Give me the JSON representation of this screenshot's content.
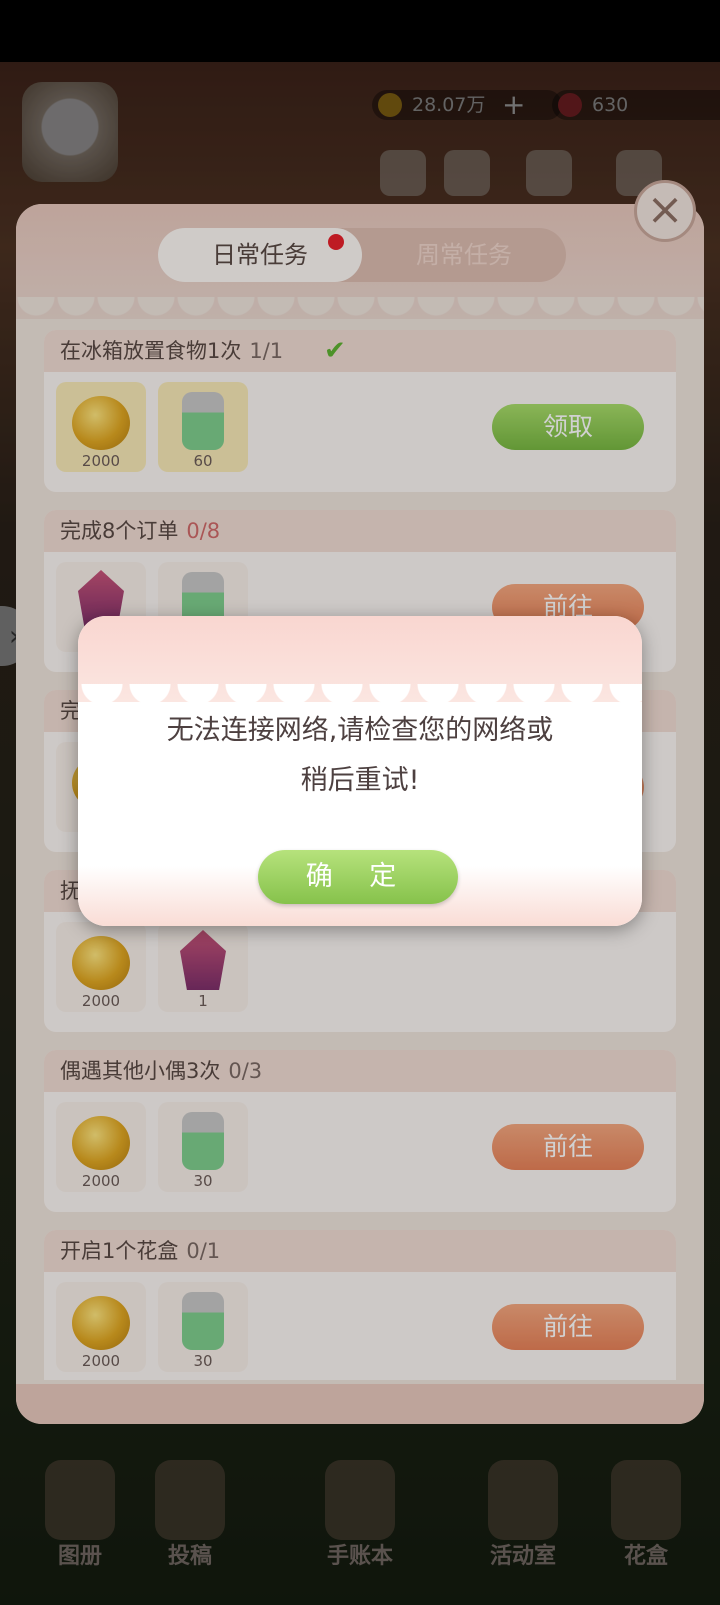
{
  "hud": {
    "gold_amount": "28.07万",
    "gold_plus": "+",
    "gem_amount": "630"
  },
  "panel": {
    "tabs": [
      {
        "label": "日常任务",
        "active": true,
        "has_dot": true
      },
      {
        "label": "周常任务",
        "active": false,
        "has_dot": false
      }
    ],
    "close_icon": "close-icon",
    "tasks": [
      {
        "title": "在冰箱放置食物1次",
        "progress": "1/1",
        "completed": true,
        "rewards": [
          {
            "icon": "gold-coin-icon",
            "qty": "2000"
          },
          {
            "icon": "time-bottle-icon",
            "qty": "60"
          }
        ],
        "action": "领取",
        "action_style": "green"
      },
      {
        "title": "完成8个订单",
        "progress": "0/8",
        "completed": false,
        "rewards": [
          {
            "icon": "gem-icon",
            "qty": ""
          },
          {
            "icon": "time-bottle-icon",
            "qty": ""
          }
        ],
        "action": "前往",
        "action_style": "orange"
      },
      {
        "title": "完",
        "progress": "",
        "completed": false,
        "rewards": [
          {
            "icon": "gold-coin-icon",
            "qty": ""
          }
        ],
        "action": "",
        "action_style": "orange"
      },
      {
        "title": "抚",
        "progress": "",
        "completed": false,
        "rewards": [
          {
            "icon": "gold-coin-icon",
            "qty": "2000"
          },
          {
            "icon": "purple-crystal-icon",
            "qty": "1"
          }
        ],
        "action": "",
        "action_style": "orange"
      },
      {
        "title": "偶遇其他小偶3次",
        "progress": "0/3",
        "completed": false,
        "rewards": [
          {
            "icon": "gold-coin-icon",
            "qty": "2000"
          },
          {
            "icon": "time-bottle-icon",
            "qty": "30"
          }
        ],
        "action": "前往",
        "action_style": "orange"
      },
      {
        "title": "开启1个花盒",
        "progress": "0/1",
        "completed": false,
        "rewards": [
          {
            "icon": "gold-coin-icon",
            "qty": "2000"
          },
          {
            "icon": "time-bottle-icon",
            "qty": "30"
          }
        ],
        "action": "前往",
        "action_style": "orange"
      }
    ]
  },
  "bottom_nav": [
    {
      "label": "图册"
    },
    {
      "label": "投稿"
    },
    {
      "label": "手账本"
    },
    {
      "label": "活动室"
    },
    {
      "label": "花盒"
    }
  ],
  "dialog": {
    "message_line1": "无法连接网络,请检查您的网络或",
    "message_line2": "稍后重试!",
    "confirm_label": "确 定"
  }
}
